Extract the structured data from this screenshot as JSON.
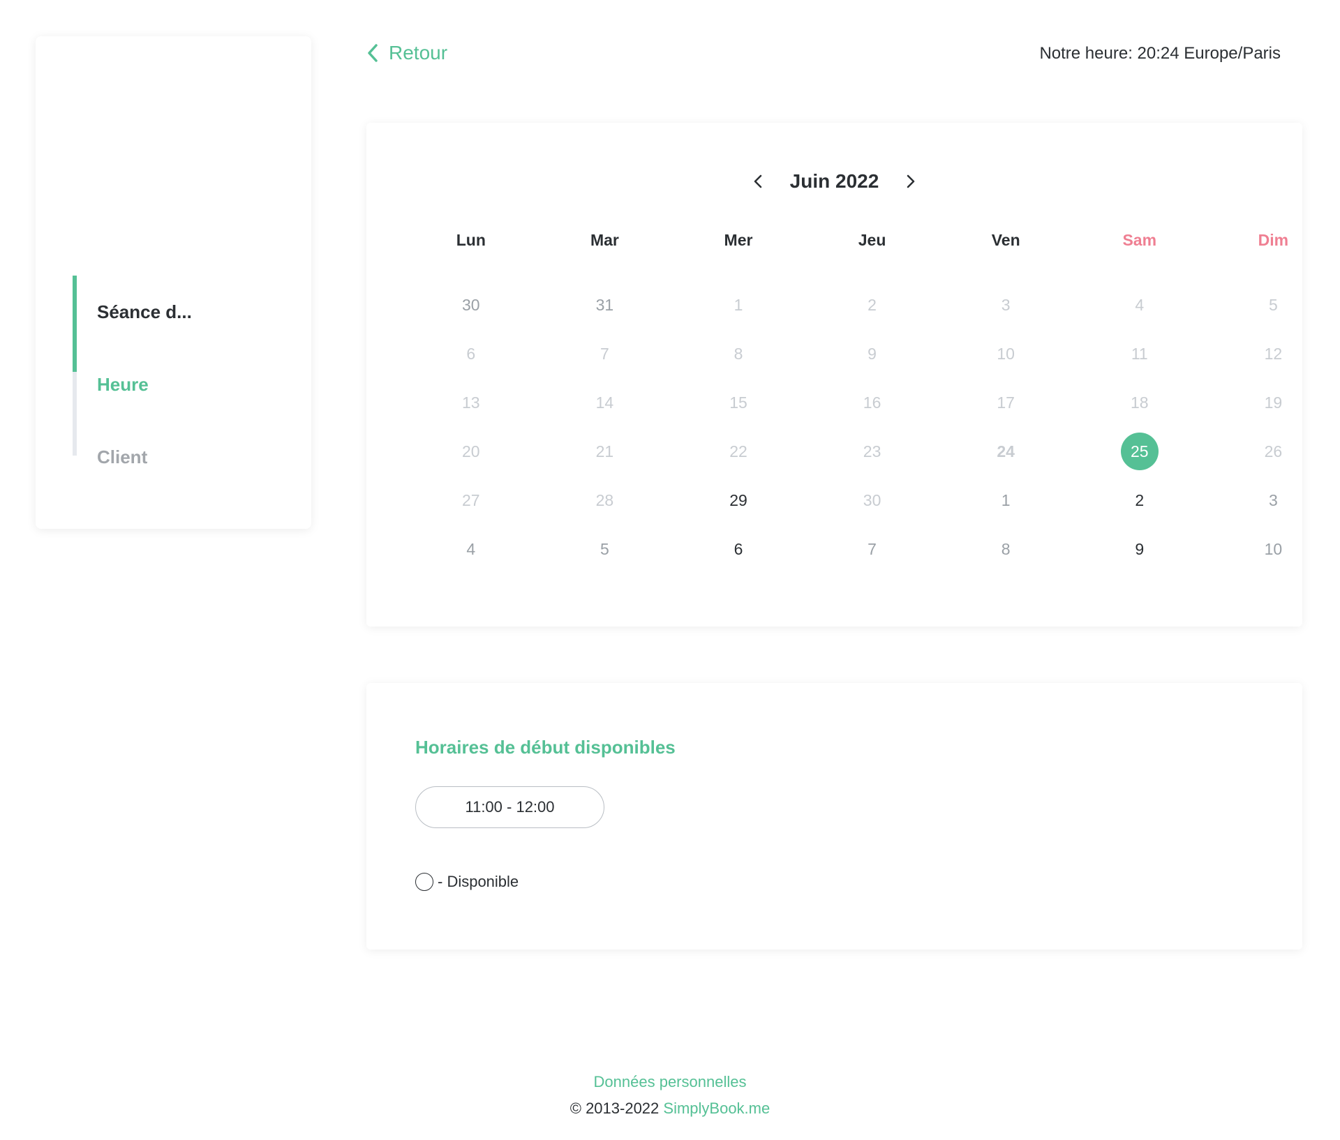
{
  "sidebar": {
    "steps": [
      {
        "label": "Séance d...",
        "state": "done"
      },
      {
        "label": "Heure",
        "state": "active"
      },
      {
        "label": "Client",
        "state": "pending"
      }
    ]
  },
  "header": {
    "back_label": "Retour",
    "time_info": "Notre heure: 20:24 Europe/Paris"
  },
  "calendar": {
    "month_label": "Juin 2022",
    "weekdays": [
      "Lun",
      "Mar",
      "Mer",
      "Jeu",
      "Ven",
      "Sam",
      "Dim"
    ],
    "weeks": [
      [
        {
          "d": "30",
          "s": "muted"
        },
        {
          "d": "31",
          "s": "muted"
        },
        {
          "d": "1",
          "s": "past"
        },
        {
          "d": "2",
          "s": "past"
        },
        {
          "d": "3",
          "s": "past"
        },
        {
          "d": "4",
          "s": "past"
        },
        {
          "d": "5",
          "s": "past"
        }
      ],
      [
        {
          "d": "6",
          "s": "past"
        },
        {
          "d": "7",
          "s": "past"
        },
        {
          "d": "8",
          "s": "past"
        },
        {
          "d": "9",
          "s": "past"
        },
        {
          "d": "10",
          "s": "past"
        },
        {
          "d": "11",
          "s": "past"
        },
        {
          "d": "12",
          "s": "past"
        }
      ],
      [
        {
          "d": "13",
          "s": "past"
        },
        {
          "d": "14",
          "s": "past"
        },
        {
          "d": "15",
          "s": "past"
        },
        {
          "d": "16",
          "s": "past"
        },
        {
          "d": "17",
          "s": "past"
        },
        {
          "d": "18",
          "s": "past"
        },
        {
          "d": "19",
          "s": "past"
        }
      ],
      [
        {
          "d": "20",
          "s": "past"
        },
        {
          "d": "21",
          "s": "past"
        },
        {
          "d": "22",
          "s": "past"
        },
        {
          "d": "23",
          "s": "past"
        },
        {
          "d": "24",
          "s": "today"
        },
        {
          "d": "25",
          "s": "selected"
        },
        {
          "d": "26",
          "s": "past"
        }
      ],
      [
        {
          "d": "27",
          "s": "past"
        },
        {
          "d": "28",
          "s": "past"
        },
        {
          "d": "29",
          "s": "avail"
        },
        {
          "d": "30",
          "s": "past"
        },
        {
          "d": "1",
          "s": "muted"
        },
        {
          "d": "2",
          "s": "avail"
        },
        {
          "d": "3",
          "s": "muted"
        }
      ],
      [
        {
          "d": "4",
          "s": "muted"
        },
        {
          "d": "5",
          "s": "muted"
        },
        {
          "d": "6",
          "s": "avail"
        },
        {
          "d": "7",
          "s": "muted"
        },
        {
          "d": "8",
          "s": "muted"
        },
        {
          "d": "9",
          "s": "avail"
        },
        {
          "d": "10",
          "s": "muted"
        }
      ]
    ]
  },
  "times": {
    "title": "Horaires de début disponibles",
    "slots": [
      "11:00 - 12:00"
    ],
    "legend_label": "- Disponible"
  },
  "footer": {
    "privacy_label": "Données personnelles",
    "copyright": "© 2013-2022",
    "brand_label": "SimplyBook.me"
  },
  "colors": {
    "accent": "#55c095",
    "weekend": "#ef7f92",
    "text": "#2b2f33",
    "disabled": "#c8ccd1"
  }
}
